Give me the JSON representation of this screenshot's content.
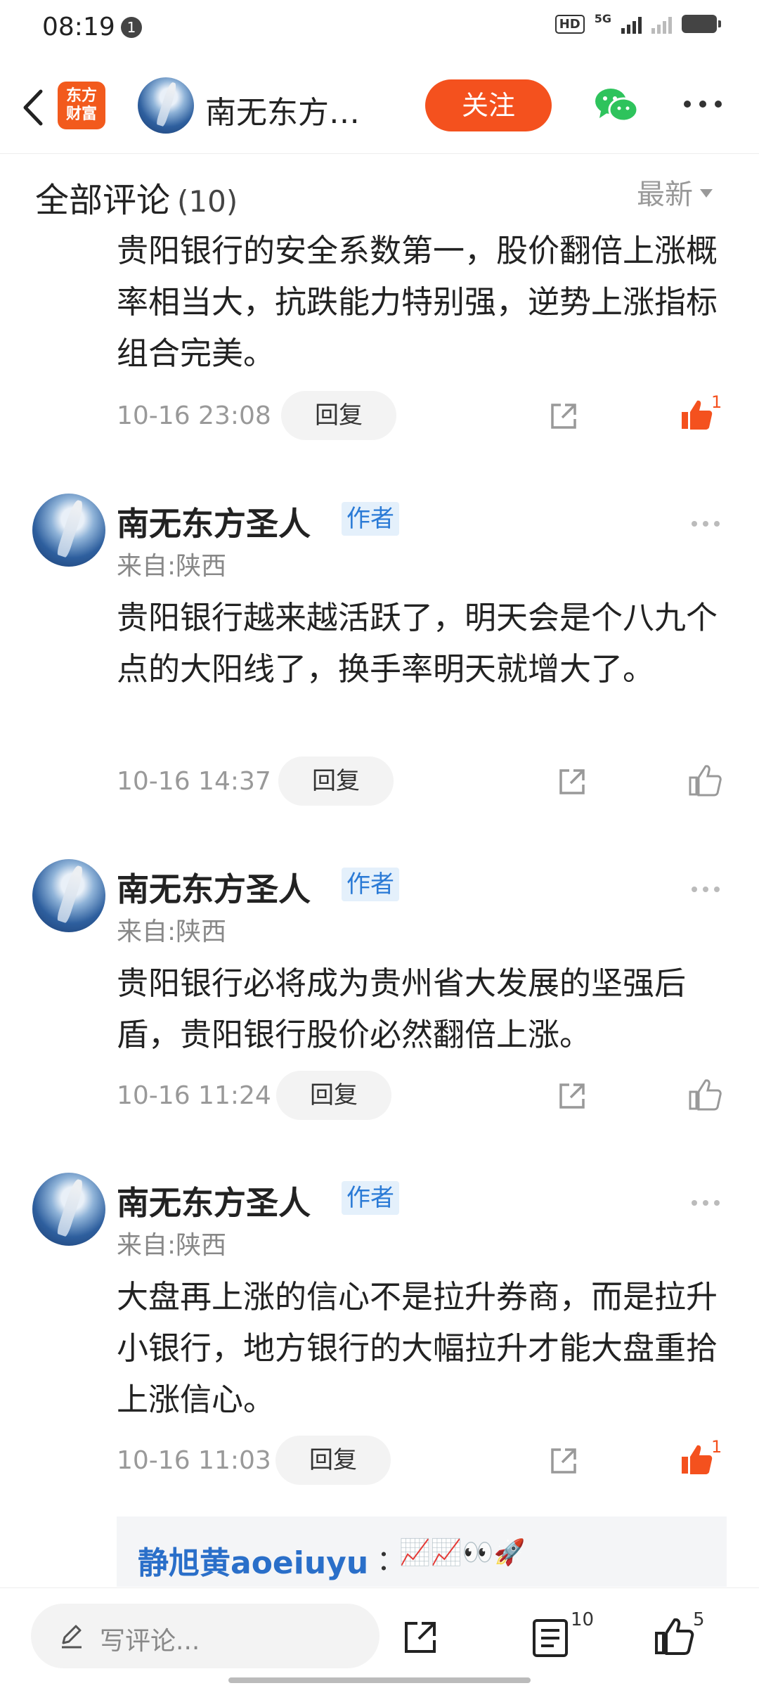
{
  "status_bar": {
    "time": "08:19",
    "notification_count": "1",
    "hd": "HD",
    "network": "5G"
  },
  "header": {
    "app_logo_line1": "东方",
    "app_logo_line2": "财富",
    "title": "南无东方…",
    "follow_label": "关注"
  },
  "comments_section": {
    "title": "全部评论",
    "count": "(10)",
    "sort_label": "最新"
  },
  "comments": [
    {
      "content": "贵阳银行的安全系数第一，股价翻倍上涨概率相当大，抗跌能力特别强，逆势上涨指标组合完美。",
      "time": "10-16 23:08",
      "reply_label": "回复",
      "likes": "1",
      "liked": true
    },
    {
      "username": "南无东方圣人",
      "badge": "作者",
      "location": "来自:陕西",
      "content": "贵阳银行越来越活跃了，明天会是个八九个点的大阳线了，换手率明天就增大了。",
      "time": "10-16 14:37",
      "reply_label": "回复",
      "liked": false
    },
    {
      "username": "南无东方圣人",
      "badge": "作者",
      "location": "来自:陕西",
      "content": "贵阳银行必将成为贵州省大发展的坚强后盾，贵阳银行股价必然翻倍上涨。",
      "time": "10-16 11:24",
      "reply_label": "回复",
      "liked": false
    },
    {
      "username": "南无东方圣人",
      "badge": "作者",
      "location": "来自:陕西",
      "content": "大盘再上涨的信心不是拉升券商，而是拉升小银行，地方银行的大幅拉升才能大盘重拾上涨信心。",
      "time": "10-16 11:03",
      "reply_label": "回复",
      "likes": "1",
      "liked": true
    }
  ],
  "sub_reply": {
    "username": "静旭黄aoeiuyu",
    "colon": "：",
    "emojis": "📈📈👀🚀"
  },
  "bottom_bar": {
    "input_placeholder": "写评论...",
    "comment_count": "10",
    "like_count": "5"
  },
  "colors": {
    "accent": "#f4511e",
    "link": "#2a6fc9",
    "badge_bg": "#e4f0fb"
  }
}
